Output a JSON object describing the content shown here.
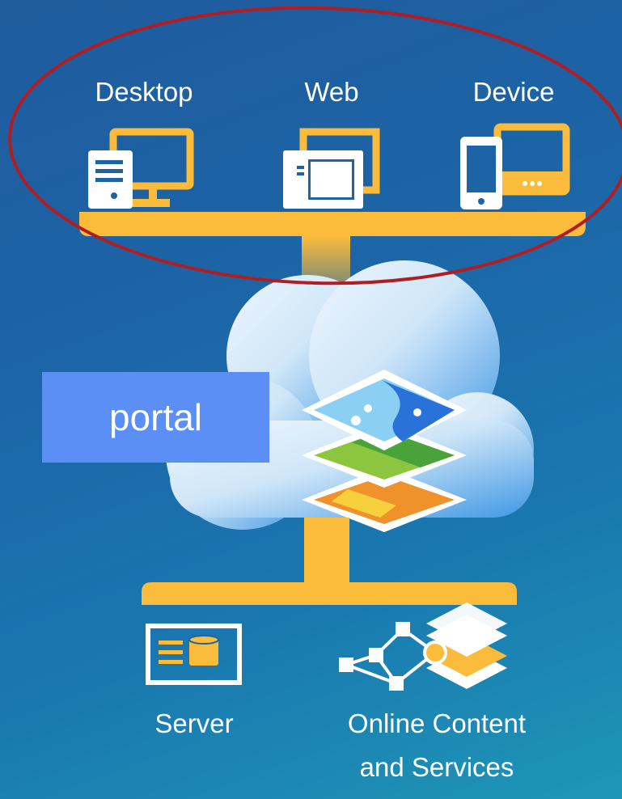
{
  "clients": [
    {
      "label": "Desktop",
      "icon": "desktop-computer-icon"
    },
    {
      "label": "Web",
      "icon": "web-browser-icon"
    },
    {
      "label": "Device",
      "icon": "mobile-tablet-icon"
    }
  ],
  "portal": {
    "label": "portal",
    "icon": "map-layers-icon"
  },
  "backends": [
    {
      "label": "Server",
      "icon": "server-icon"
    },
    {
      "label_line1": "Online Content",
      "label_line2": "and Services",
      "icon": "network-layers-icon"
    }
  ],
  "colors": {
    "accent": "#fbbc3b",
    "highlight_ellipse": "#b01e23",
    "portal_box": "#5b8ff5",
    "cloud_light": "#e9f4fc",
    "cloud_dark": "#4fa0e6"
  }
}
